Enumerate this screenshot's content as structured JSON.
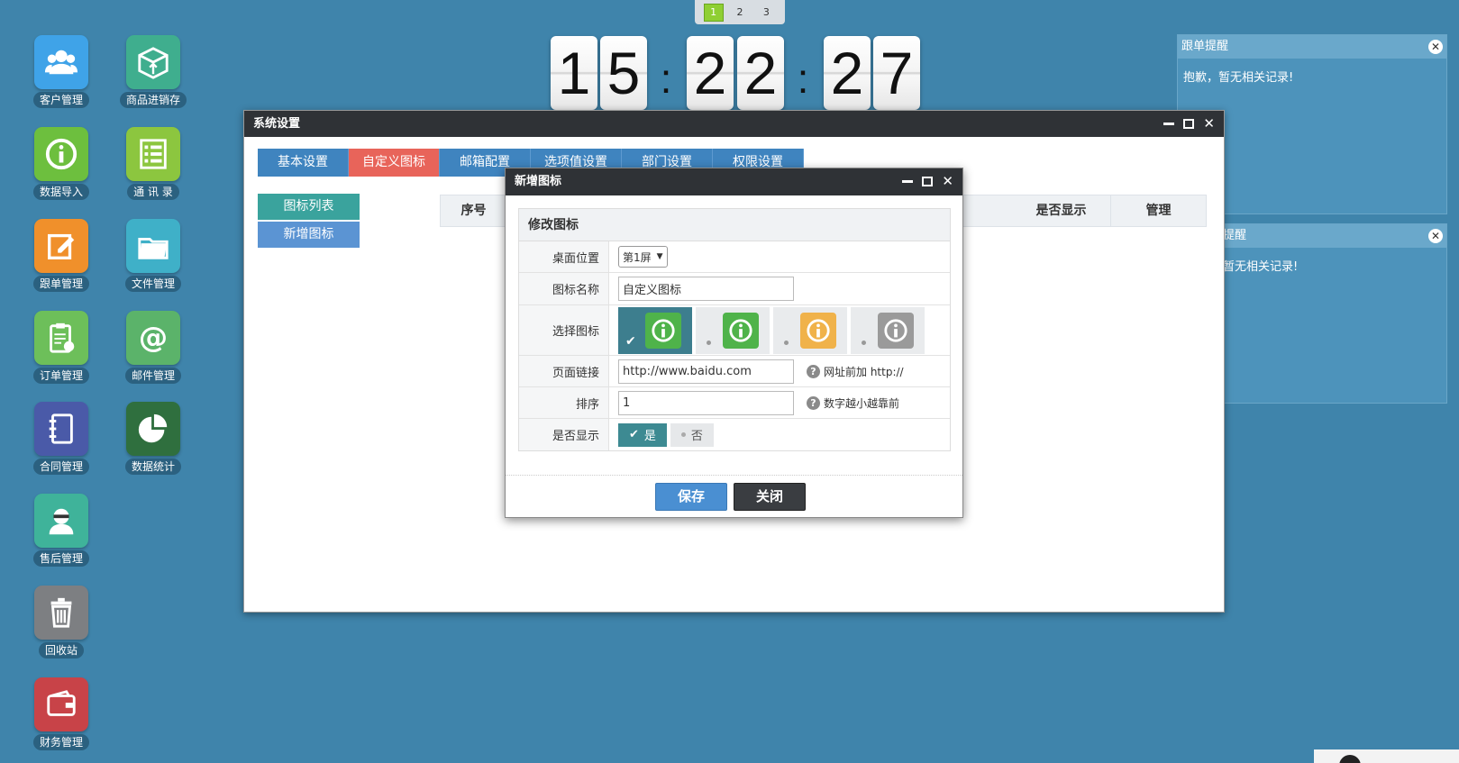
{
  "desktop_icons": [
    {
      "label": "客户管理",
      "icon": "users-icon",
      "color": "#3fa3e8"
    },
    {
      "label": "商品进销存",
      "icon": "box-icon",
      "color": "#3fae8e"
    },
    {
      "label": "数据导入",
      "icon": "info-icon",
      "color": "#6dbf3e"
    },
    {
      "label": "通 讯 录",
      "icon": "list-icon",
      "color": "#8cc63f"
    },
    {
      "label": "跟单管理",
      "icon": "edit-icon",
      "color": "#f0902b"
    },
    {
      "label": "文件管理",
      "icon": "folder-icon",
      "color": "#3fb0c8"
    },
    {
      "label": "订单管理",
      "icon": "clipboard-icon",
      "color": "#6dbf5a"
    },
    {
      "label": "邮件管理",
      "icon": "at-icon",
      "color": "#5bb36a"
    },
    {
      "label": "合同管理",
      "icon": "notebook-icon",
      "color": "#4a5aa8"
    },
    {
      "label": "数据统计",
      "icon": "pie-chart-icon",
      "color": "#2f6f3e"
    },
    {
      "label": "售后管理",
      "icon": "support-agent-icon",
      "color": "#3fb39a"
    },
    {
      "label": "回收站",
      "icon": "trash-icon",
      "color": "#7d7f82"
    },
    {
      "label": "财务管理",
      "icon": "wallet-icon",
      "color": "#c84348"
    }
  ],
  "screen_switcher": [
    "1",
    "2",
    "3"
  ],
  "clock": {
    "h1": "1",
    "h2": "5",
    "m1": "2",
    "m2": "2",
    "s1": "2",
    "s2": "7",
    "sep": ":"
  },
  "notices": [
    {
      "title": "跟单提醒",
      "body": "抱歉，暂无相关记录!"
    },
    {
      "title": "提醒",
      "body": "暂无相关记录!"
    }
  ],
  "sys_window": {
    "title": "系统设置",
    "tabs": [
      "基本设置",
      "自定义图标",
      "邮箱配置",
      "选项值设置",
      "部门设置",
      "权限设置"
    ],
    "side_menu": [
      "图标列表",
      "新增图标"
    ],
    "table_headers": [
      "序号",
      "",
      "",
      "",
      "",
      "",
      "是否显示",
      "管理"
    ]
  },
  "dialog": {
    "title": "新增图标",
    "form_title": "修改图标",
    "labels": {
      "position": "桌面位置",
      "name": "图标名称",
      "icon": "选择图标",
      "link": "页面链接",
      "order": "排序",
      "show": "是否显示"
    },
    "position_value": "第1屏",
    "name_value": "自定义图标",
    "icon_options": [
      {
        "color": "#4fb34a",
        "selected": true
      },
      {
        "color": "#4fb34a",
        "selected": false
      },
      {
        "color": "#f0b24a",
        "selected": false
      },
      {
        "color": "#9a9a9a",
        "selected": false
      }
    ],
    "link_value": "http://www.baidu.com",
    "link_hint": "网址前加 http://",
    "order_value": "1",
    "order_hint": "数字越小越靠前",
    "yes": "是",
    "no": "否",
    "save": "保存",
    "close": "关闭"
  }
}
